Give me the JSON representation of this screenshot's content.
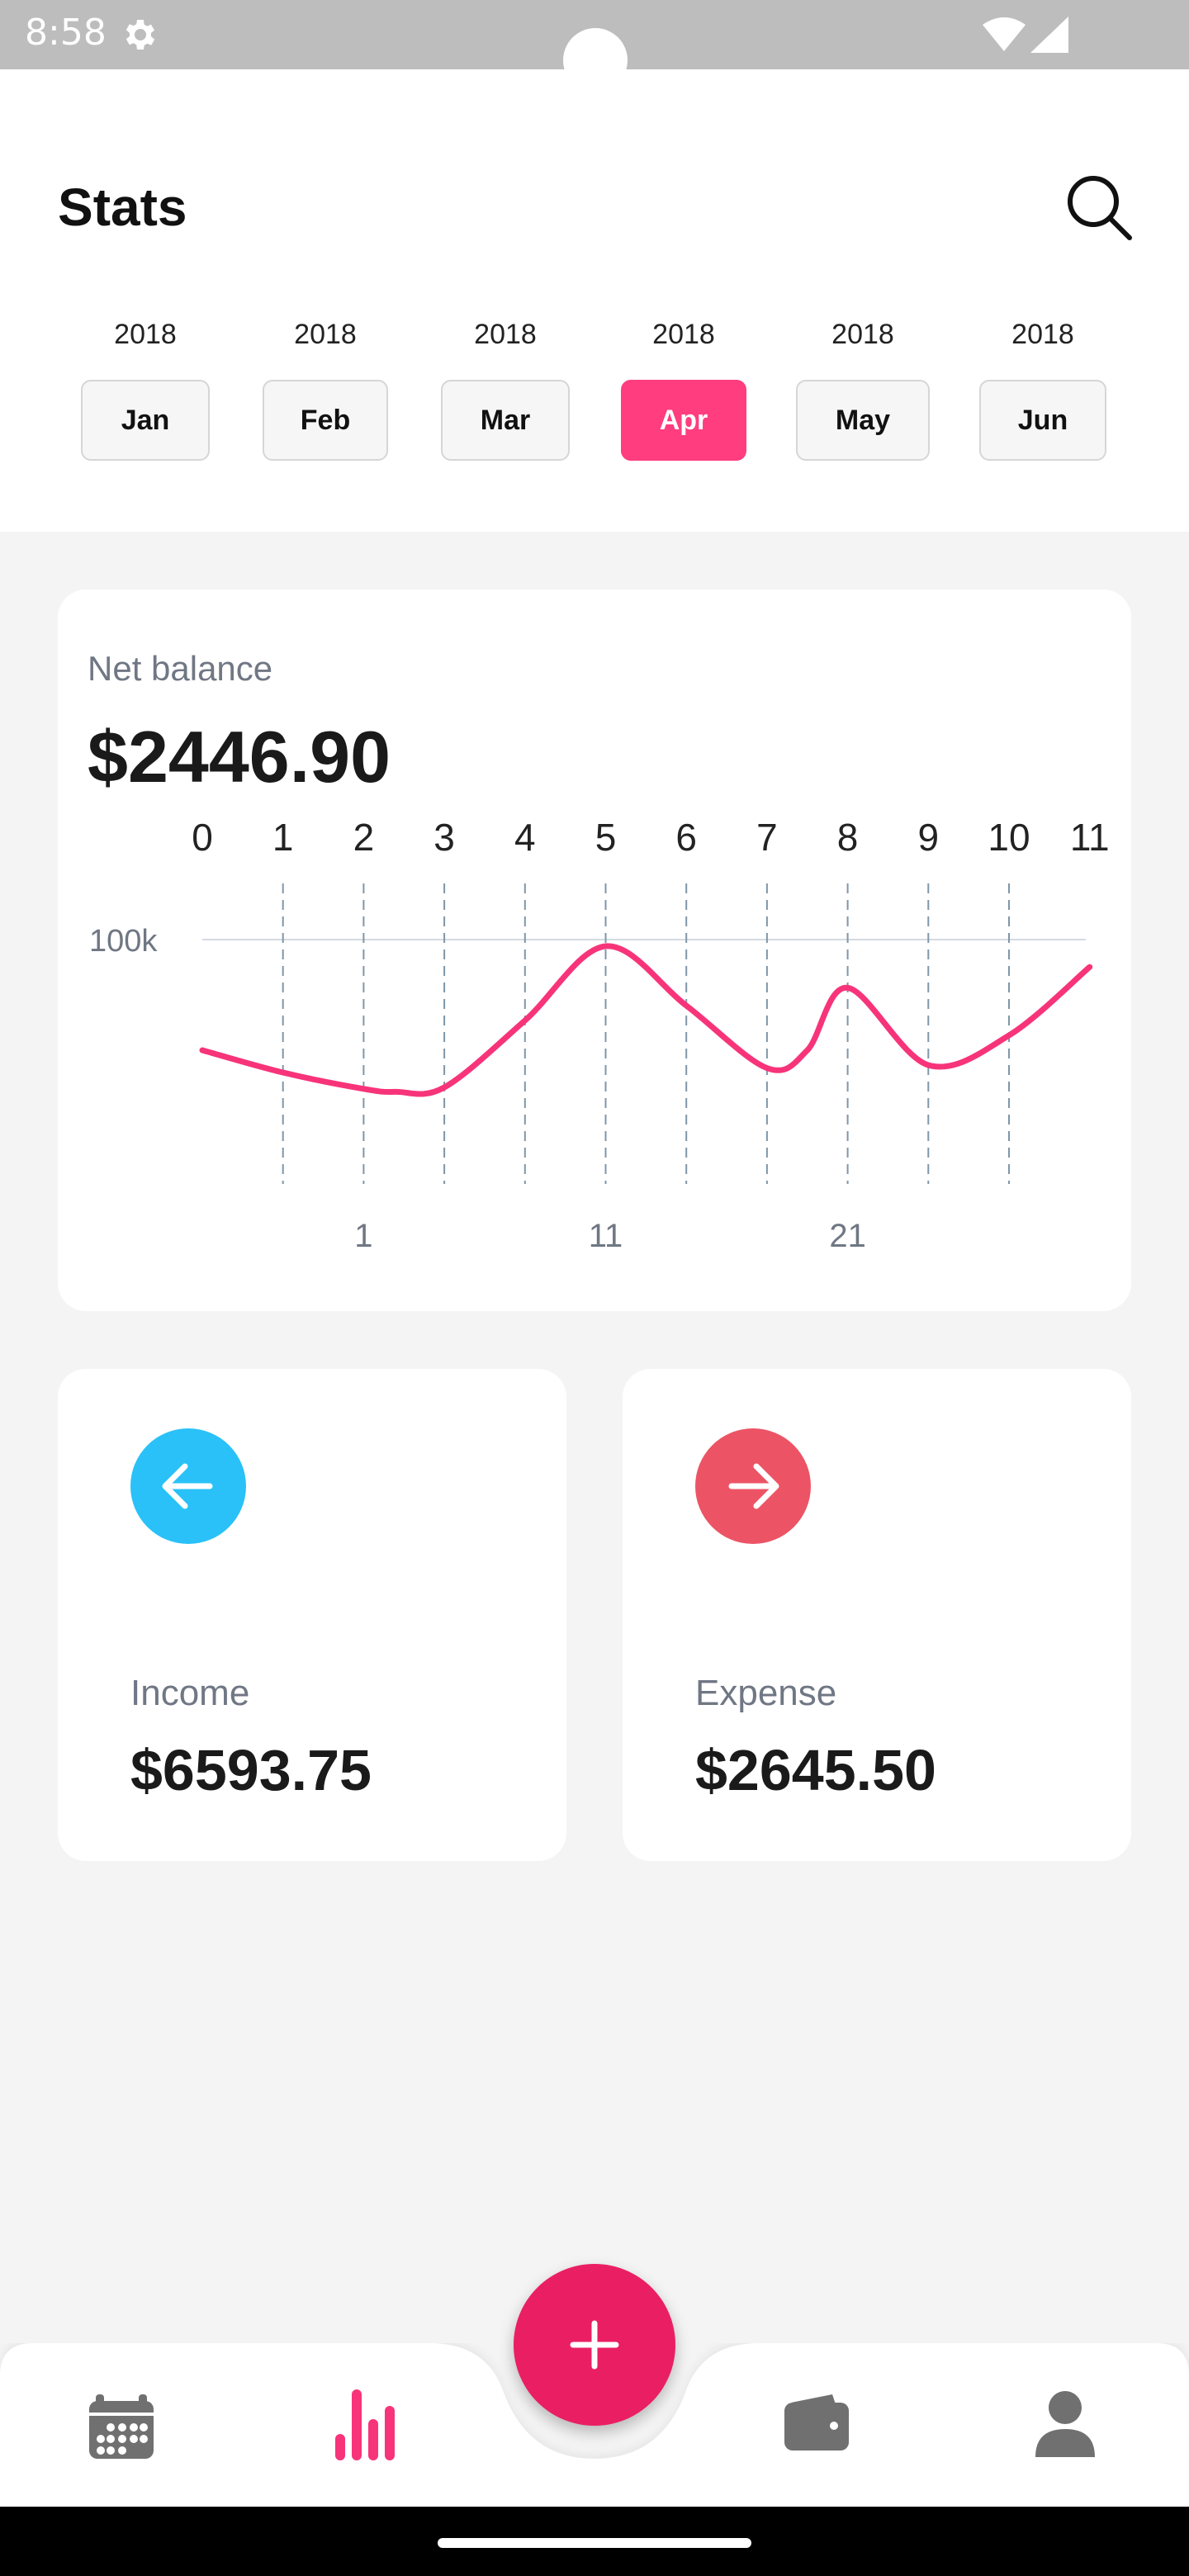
{
  "status_bar": {
    "time": "8:58"
  },
  "header": {
    "title": "Stats"
  },
  "months": [
    {
      "year": "2018",
      "label": "Jan",
      "active": false
    },
    {
      "year": "2018",
      "label": "Feb",
      "active": false
    },
    {
      "year": "2018",
      "label": "Mar",
      "active": false
    },
    {
      "year": "2018",
      "label": "Apr",
      "active": true
    },
    {
      "year": "2018",
      "label": "May",
      "active": false
    },
    {
      "year": "2018",
      "label": "Jun",
      "active": false
    }
  ],
  "net_balance": {
    "label": "Net balance",
    "amount": "$2446.90"
  },
  "chart_data": {
    "type": "line",
    "top_ticks": [
      "0",
      "1",
      "2",
      "3",
      "4",
      "5",
      "6",
      "7",
      "8",
      "9",
      "10",
      "11"
    ],
    "bottom_ticks": [
      "1",
      "11",
      "21"
    ],
    "y_reference_label": "100k",
    "series": [
      {
        "x": [
          0,
          1,
          2,
          2.4,
          3,
          4,
          5,
          6,
          7,
          7.5,
          8,
          9,
          10,
          11
        ],
        "values": [
          0.3,
          0.15,
          0.04,
          0.02,
          0.05,
          0.5,
          1.0,
          0.6,
          0.18,
          0.3,
          0.72,
          0.2,
          0.4,
          0.86
        ]
      }
    ],
    "color": "#f7347a",
    "grid": true
  },
  "income": {
    "label": "Income",
    "amount": "$6593.75",
    "color": "#29c1f8",
    "icon": "arrow-left-icon"
  },
  "expense": {
    "label": "Expense",
    "amount": "$2645.50",
    "color": "#ec5465",
    "icon": "arrow-right-icon"
  },
  "nav": {
    "items": [
      "calendar-icon",
      "bar-chart-icon",
      "wallet-icon",
      "person-icon"
    ],
    "fab_icon": "plus-icon",
    "active_color": "#f7347a",
    "inactive_color": "#707070"
  }
}
